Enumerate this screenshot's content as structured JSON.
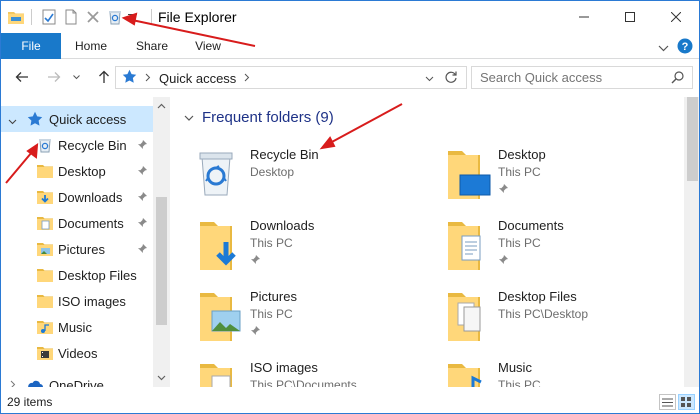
{
  "window": {
    "title": "File Explorer",
    "quick_access_toolbar": {
      "items": [
        "properties-icon",
        "new-folder-icon",
        "delete-icon",
        "recycle-bin-icon"
      ],
      "dropdown_icon": "chevron-down-icon"
    },
    "controls": [
      "minimize-icon",
      "maximize-icon",
      "close-icon"
    ]
  },
  "ribbon": {
    "tabs": [
      {
        "label": "File"
      },
      {
        "label": "Home"
      },
      {
        "label": "Share"
      },
      {
        "label": "View"
      }
    ]
  },
  "address": {
    "path_label": "Quick access",
    "search_placeholder": "Search Quick access"
  },
  "navpane": {
    "root": {
      "label": "Quick access"
    },
    "items": [
      {
        "label": "Recycle Bin",
        "icon": "recycle-bin-icon",
        "pinned": true
      },
      {
        "label": "Desktop",
        "icon": "folder-icon",
        "pinned": true
      },
      {
        "label": "Downloads",
        "icon": "downloads-folder-icon",
        "pinned": true
      },
      {
        "label": "Documents",
        "icon": "documents-folder-icon",
        "pinned": true
      },
      {
        "label": "Pictures",
        "icon": "pictures-folder-icon",
        "pinned": true
      },
      {
        "label": "Desktop Files",
        "icon": "folder-icon",
        "pinned": false
      },
      {
        "label": "ISO images",
        "icon": "folder-icon",
        "pinned": false
      },
      {
        "label": "Music",
        "icon": "music-folder-icon",
        "pinned": false
      },
      {
        "label": "Videos",
        "icon": "videos-folder-icon",
        "pinned": false
      }
    ],
    "onedrive": {
      "label": "OneDrive"
    }
  },
  "content": {
    "group_title": "Frequent folders (9)",
    "tiles": [
      {
        "name": "Recycle Bin",
        "location": "Desktop",
        "pinned": false,
        "icon": "recycle-bin-icon"
      },
      {
        "name": "Desktop",
        "location": "This PC",
        "pinned": true,
        "icon": "desktop-folder-icon"
      },
      {
        "name": "Downloads",
        "location": "This PC",
        "pinned": true,
        "icon": "downloads-folder-icon"
      },
      {
        "name": "Documents",
        "location": "This PC",
        "pinned": true,
        "icon": "documents-folder-icon"
      },
      {
        "name": "Pictures",
        "location": "This PC",
        "pinned": true,
        "icon": "pictures-folder-icon"
      },
      {
        "name": "Desktop Files",
        "location": "This PC\\Desktop",
        "pinned": false,
        "icon": "folder-icon"
      },
      {
        "name": "ISO images",
        "location": "This PC\\Documents",
        "pinned": false,
        "icon": "folder-icon"
      },
      {
        "name": "Music",
        "location": "This PC",
        "pinned": false,
        "icon": "music-folder-icon"
      }
    ]
  },
  "status": {
    "item_count": "29 items"
  },
  "colors": {
    "accent": "#1979ca",
    "selection": "#cce8ff",
    "group_title": "#1e3287",
    "annotation_arrow": "#d81c1c"
  }
}
